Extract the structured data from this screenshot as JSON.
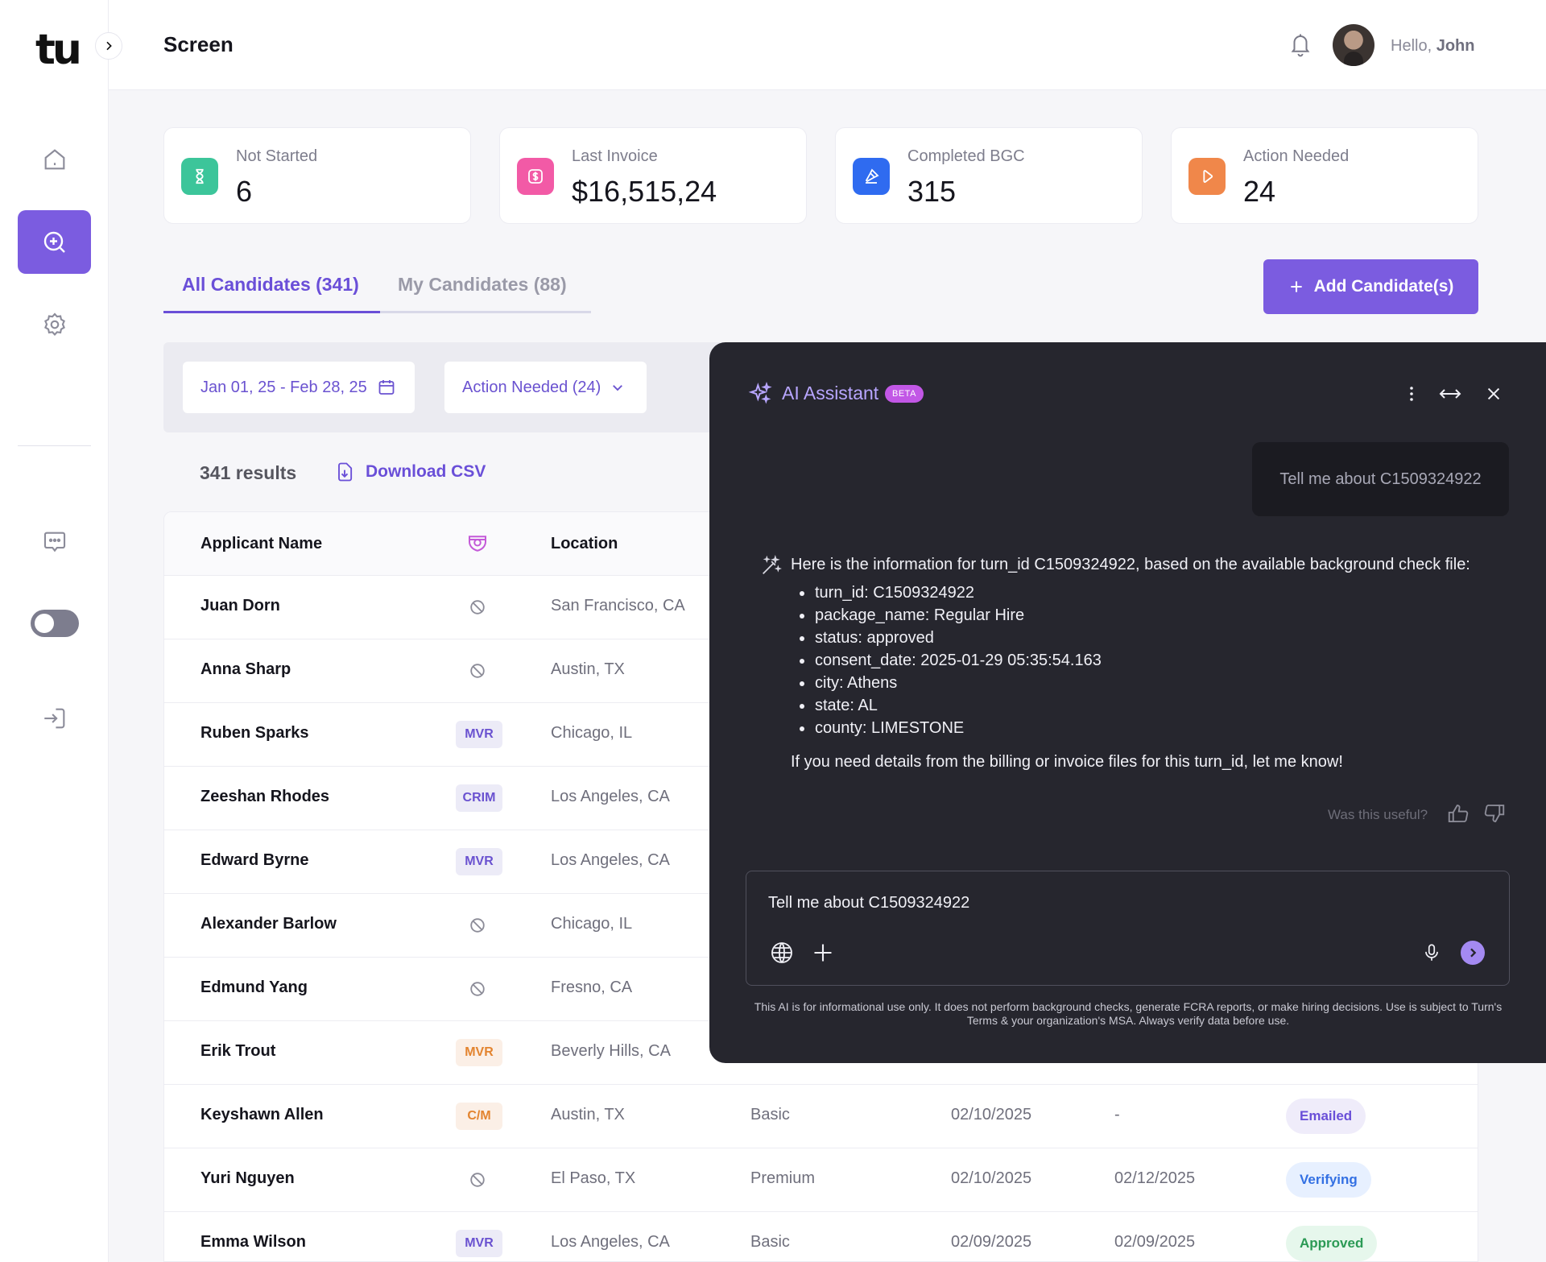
{
  "app": {
    "logo": "tu",
    "page_title": "Screen"
  },
  "header": {
    "greeting_prefix": "Hello,",
    "user_name": "John"
  },
  "stats": [
    {
      "label": "Not Started",
      "value": "6",
      "icon": "hourglass-icon",
      "color": "#3cc59a"
    },
    {
      "label": "Last Invoice",
      "value": "$16,515,24",
      "icon": "dollar-icon",
      "color": "#f25aa6"
    },
    {
      "label": "Completed BGC",
      "value": "315",
      "icon": "stamp-icon",
      "color": "#2f6bf0"
    },
    {
      "label": "Action Needed",
      "value": "24",
      "icon": "play-icon",
      "color": "#f0874a"
    }
  ],
  "tabs": [
    {
      "label": "All Candidates (341)",
      "active": true
    },
    {
      "label": "My Candidates (88)",
      "active": false
    }
  ],
  "add_button": {
    "label": "Add Candidate(s)"
  },
  "filters": {
    "date_range": "Jan 01, 25 - Feb 28, 25",
    "status": "Action Needed (24)"
  },
  "results": {
    "count": "341 results",
    "download": "Download CSV"
  },
  "table": {
    "columns": [
      "Applicant Name",
      "Location"
    ],
    "rows": [
      {
        "name": "Juan Dorn",
        "type": "",
        "location": "San Francisco, CA",
        "package": "",
        "date1": "",
        "date2": "",
        "status": ""
      },
      {
        "name": "Anna Sharp",
        "type": "",
        "location": "Austin, TX",
        "package": "",
        "date1": "",
        "date2": "",
        "status": ""
      },
      {
        "name": "Ruben Sparks",
        "type": "MVR",
        "location": "Chicago, IL",
        "package": "",
        "date1": "",
        "date2": "",
        "status": ""
      },
      {
        "name": "Zeeshan Rhodes",
        "type": "CRIM",
        "location": "Los Angeles, CA",
        "package": "",
        "date1": "",
        "date2": "",
        "status": ""
      },
      {
        "name": "Edward Byrne",
        "type": "MVR",
        "location": "Los Angeles, CA",
        "package": "",
        "date1": "",
        "date2": "",
        "status": ""
      },
      {
        "name": "Alexander Barlow",
        "type": "",
        "location": "Chicago, IL",
        "package": "",
        "date1": "",
        "date2": "",
        "status": ""
      },
      {
        "name": "Edmund Yang",
        "type": "",
        "location": "Fresno, CA",
        "package": "",
        "date1": "",
        "date2": "",
        "status": ""
      },
      {
        "name": "Erik Trout",
        "type": "MVR",
        "location": "Beverly Hills, CA",
        "package": "",
        "date1": "",
        "date2": "",
        "status": ""
      },
      {
        "name": "Keyshawn Allen",
        "type": "C/M",
        "location": "Austin, TX",
        "package": "Basic",
        "date1": "02/10/2025",
        "date2": "-",
        "status": "Emailed"
      },
      {
        "name": "Yuri Nguyen",
        "type": "",
        "location": "El Paso, TX",
        "package": "Premium",
        "date1": "02/10/2025",
        "date2": "02/12/2025",
        "status": "Verifying"
      },
      {
        "name": "Emma Wilson",
        "type": "MVR",
        "location": "Los Angeles, CA",
        "package": "Basic",
        "date1": "02/09/2025",
        "date2": "02/09/2025",
        "status": "Approved"
      }
    ]
  },
  "ai": {
    "title": "AI Assistant",
    "badge": "BETA",
    "user_message": "Tell me about C1509324922",
    "response_intro": "Here is the information for turn_id C1509324922, based on the available background check file:",
    "response_items": [
      "turn_id: C1509324922",
      "package_name: Regular Hire",
      "status: approved",
      "consent_date: 2025-01-29 05:35:54.163",
      "city: Athens",
      "state: AL",
      "county: LIMESTONE"
    ],
    "response_outro": "If you need details from the billing or invoice files for this turn_id, let me know!",
    "feedback_prompt": "Was this useful?",
    "input_value": "Tell me about C1509324922",
    "disclaimer": "This AI is for informational use only. It does not perform background checks, generate FCRA reports, or make hiring decisions. Use is subject to Turn's Terms & your organization's MSA. Always verify data before use."
  }
}
